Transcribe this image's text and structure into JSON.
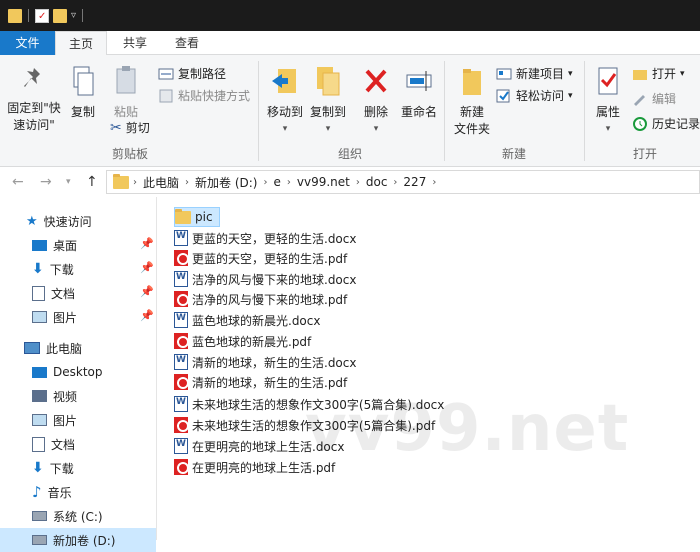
{
  "ribbon_tabs": [
    "文件",
    "主页",
    "共享",
    "查看"
  ],
  "ribbon": {
    "pin_quick_access": "固定到\"快\n速访问\"",
    "copy": "复制",
    "paste": "粘贴",
    "copy_path": "复制路径",
    "paste_shortcut": "粘贴快捷方式",
    "cut": "剪切",
    "group_clipboard": "剪贴板",
    "move_to": "移动到",
    "copy_to": "复制到",
    "delete": "删除",
    "rename": "重命名",
    "group_organize": "组织",
    "new_folder": "新建\n文件夹",
    "new_item": "新建项目",
    "easy_access": "轻松访问",
    "group_new": "新建",
    "properties": "属性",
    "open": "打开",
    "edit": "编辑",
    "history": "历史记录",
    "group_open": "打开"
  },
  "address": {
    "crumbs": [
      "此电脑",
      "新加卷 (D:)",
      "e",
      "vv99.net",
      "doc",
      "227"
    ]
  },
  "sidebar": {
    "quick_access": "快速访问",
    "quick_items": [
      "桌面",
      "下载",
      "文档",
      "图片"
    ],
    "this_pc": "此电脑",
    "pc_items": [
      "Desktop",
      "视频",
      "图片",
      "文档",
      "下载",
      "音乐",
      "系统 (C:)",
      "新加卷 (D:)"
    ]
  },
  "files": [
    {
      "name": "pic",
      "type": "folder"
    },
    {
      "name": "更蓝的天空，更轻的生活.docx",
      "type": "docx"
    },
    {
      "name": "更蓝的天空，更轻的生活.pdf",
      "type": "pdf"
    },
    {
      "name": "洁净的风与慢下来的地球.docx",
      "type": "docx"
    },
    {
      "name": "洁净的风与慢下来的地球.pdf",
      "type": "pdf"
    },
    {
      "name": "蓝色地球的新晨光.docx",
      "type": "docx"
    },
    {
      "name": "蓝色地球的新晨光.pdf",
      "type": "pdf"
    },
    {
      "name": "清新的地球，新生的生活.docx",
      "type": "docx"
    },
    {
      "name": "清新的地球，新生的生活.pdf",
      "type": "pdf"
    },
    {
      "name": "未来地球生活的想象作文300字(5篇合集).docx",
      "type": "docx"
    },
    {
      "name": "未来地球生活的想象作文300字(5篇合集).pdf",
      "type": "pdf"
    },
    {
      "name": "在更明亮的地球上生活.docx",
      "type": "docx"
    },
    {
      "name": "在更明亮的地球上生活.pdf",
      "type": "pdf"
    }
  ],
  "watermark": "vv99.net",
  "colors": {
    "accent": "#1979ca",
    "selection": "#cce8ff"
  }
}
